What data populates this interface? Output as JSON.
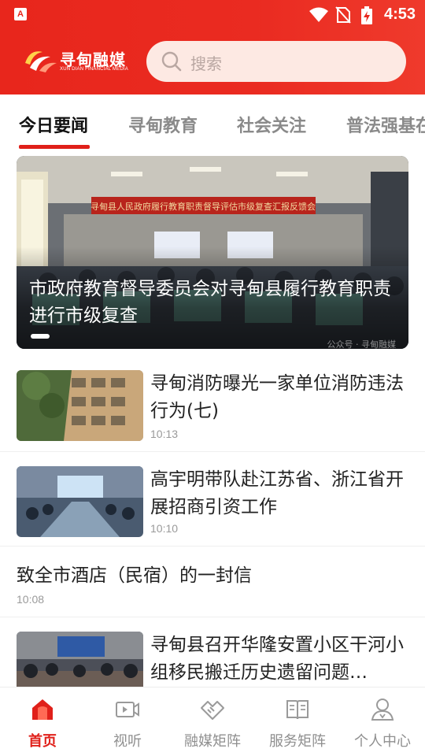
{
  "status_bar": {
    "time": "4:53",
    "app_badge": "A"
  },
  "header": {
    "logo_name": "寻甸融媒",
    "logo_sub": "XUN DIAN FINANCIAL MEDIA",
    "search_placeholder": "搜索"
  },
  "tabs": [
    {
      "label": "今日要闻",
      "active": true
    },
    {
      "label": "寻甸教育",
      "active": false
    },
    {
      "label": "社会关注",
      "active": false
    },
    {
      "label": "普法强基在",
      "active": false
    }
  ],
  "hero": {
    "title": "市政府教育督导委员会对寻甸县履行教育职责进行市级复查",
    "banner_text": "寻甸县人民政府履行教育职责督导评估市级复查汇报反馈会",
    "watermark": "公众号 · 寻甸融媒"
  },
  "news": [
    {
      "title": "寻甸消防曝光一家单位消防违法行为(七)",
      "time": "10:13",
      "has_image": true
    },
    {
      "title": "高宇明带队赴江苏省、浙江省开展招商引资工作",
      "time": "10:10",
      "has_image": true
    },
    {
      "title": "致全市酒店（民宿）的一封信",
      "time": "10:08",
      "has_image": false
    },
    {
      "title": "寻甸县召开华隆安置小区干河小组移民搬迁历史遗留问题…",
      "time": "",
      "has_image": true
    }
  ],
  "bottom_nav": [
    {
      "label": "首页",
      "icon": "home-icon",
      "active": true
    },
    {
      "label": "视听",
      "icon": "video-icon",
      "active": false
    },
    {
      "label": "融媒矩阵",
      "icon": "handshake-icon",
      "active": false
    },
    {
      "label": "服务矩阵",
      "icon": "book-icon",
      "active": false
    },
    {
      "label": "个人中心",
      "icon": "user-icon",
      "active": false
    }
  ],
  "colors": {
    "brand_red": "#e8261c",
    "tab_indicator": "#e0201a",
    "search_bg": "#fde9e3"
  }
}
